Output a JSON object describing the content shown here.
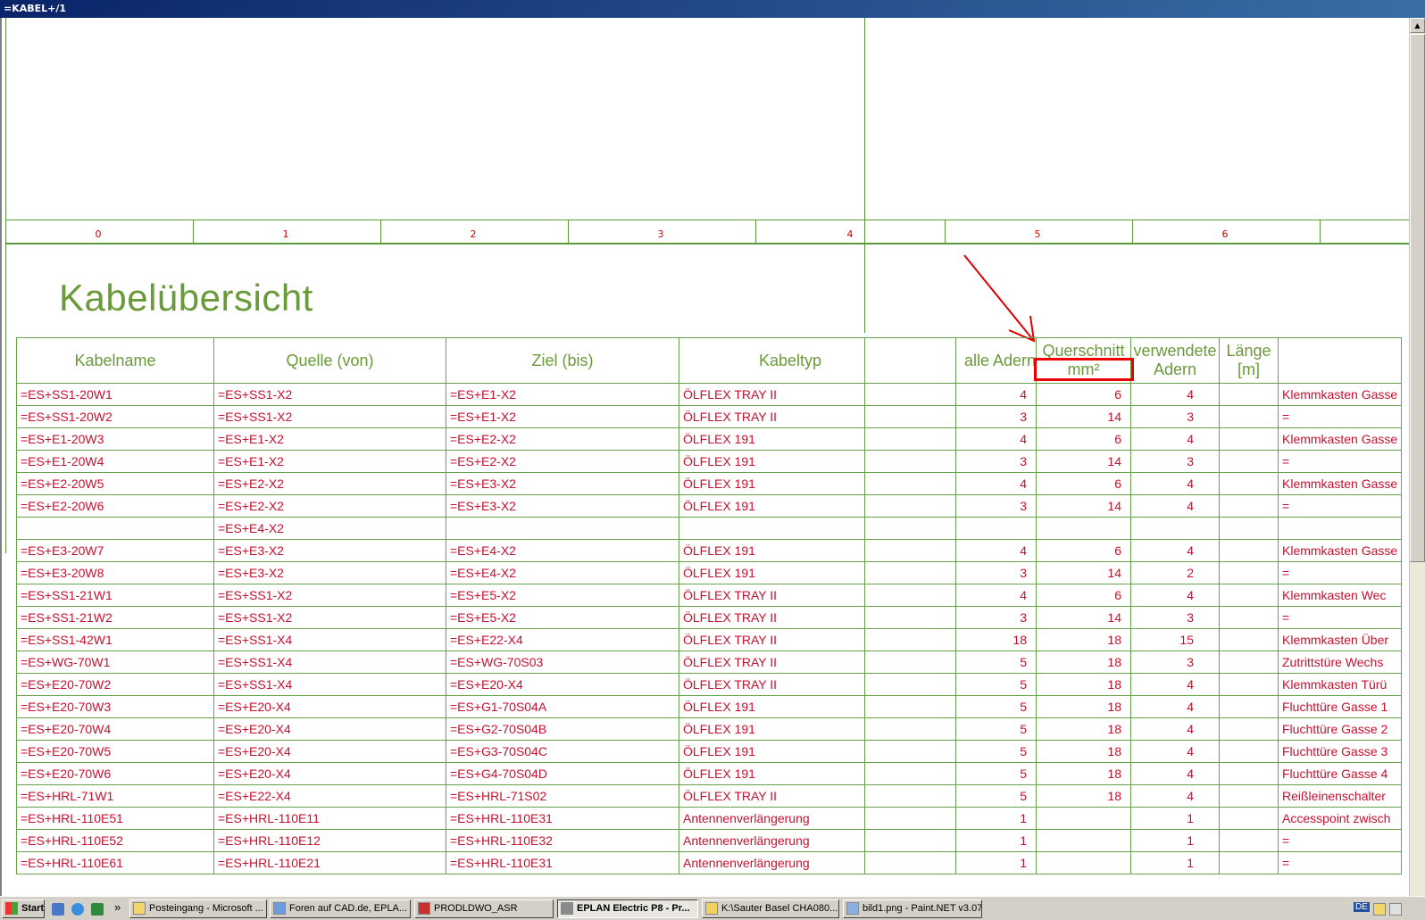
{
  "window": {
    "title": "=KABEL+/1"
  },
  "drawing": {
    "column_numbers": [
      "0",
      "1",
      "2",
      "3",
      "4",
      "5",
      "6"
    ],
    "page_title": "Kabelübersicht"
  },
  "table": {
    "headers": {
      "kabelname": "Kabelname",
      "quelle": "Quelle (von)",
      "ziel": "Ziel (bis)",
      "kabeltyp": "Kabeltyp",
      "blank": "",
      "alle_adern": "alle Adern",
      "querschnitt_1": "Querschnitt",
      "querschnitt_2": "mm²",
      "verwendete_1": "verwendete",
      "verwendete_2": "Adern",
      "laenge_1": "Länge",
      "laenge_2": "[m]",
      "last": ""
    },
    "rows": [
      [
        "=ES+SS1-20W1",
        "=ES+SS1-X2",
        "=ES+E1-X2",
        "ÖLFLEX TRAY II",
        "4",
        "6",
        "4",
        "",
        "Klemmkasten Gasse"
      ],
      [
        "=ES+SS1-20W2",
        "=ES+SS1-X2",
        "=ES+E1-X2",
        "ÖLFLEX TRAY II",
        "3",
        "14",
        "3",
        "",
        "="
      ],
      [
        "=ES+E1-20W3",
        "=ES+E1-X2",
        "=ES+E2-X2",
        "ÖLFLEX 191",
        "4",
        "6",
        "4",
        "",
        "Klemmkasten Gasse"
      ],
      [
        "=ES+E1-20W4",
        "=ES+E1-X2",
        "=ES+E2-X2",
        "ÖLFLEX 191",
        "3",
        "14",
        "3",
        "",
        "="
      ],
      [
        "=ES+E2-20W5",
        "=ES+E2-X2",
        "=ES+E3-X2",
        "ÖLFLEX 191",
        "4",
        "6",
        "4",
        "",
        "Klemmkasten Gasse"
      ],
      [
        "=ES+E2-20W6",
        "=ES+E2-X2",
        "=ES+E3-X2",
        "ÖLFLEX 191",
        "3",
        "14",
        "4",
        "",
        "="
      ],
      [
        "",
        "=ES+E4-X2",
        "",
        "",
        "",
        "",
        "",
        "",
        ""
      ],
      [
        "=ES+E3-20W7",
        "=ES+E3-X2",
        "=ES+E4-X2",
        "ÖLFLEX 191",
        "4",
        "6",
        "4",
        "",
        "Klemmkasten Gasse"
      ],
      [
        "=ES+E3-20W8",
        "=ES+E3-X2",
        "=ES+E4-X2",
        "ÖLFLEX 191",
        "3",
        "14",
        "2",
        "",
        "="
      ],
      [
        "=ES+SS1-21W1",
        "=ES+SS1-X2",
        "=ES+E5-X2",
        "ÖLFLEX TRAY II",
        "4",
        "6",
        "4",
        "",
        "Klemmkasten Wec"
      ],
      [
        "=ES+SS1-21W2",
        "=ES+SS1-X2",
        "=ES+E5-X2",
        "ÖLFLEX TRAY II",
        "3",
        "14",
        "3",
        "",
        "="
      ],
      [
        "=ES+SS1-42W1",
        "=ES+SS1-X4",
        "=ES+E22-X4",
        "ÖLFLEX TRAY II",
        "18",
        "18",
        "15",
        "",
        "Klemmkasten Über"
      ],
      [
        "=ES+WG-70W1",
        "=ES+SS1-X4",
        "=ES+WG-70S03",
        "ÖLFLEX TRAY II",
        "5",
        "18",
        "3",
        "",
        "Zutrittstüre Wechs"
      ],
      [
        "=ES+E20-70W2",
        "=ES+SS1-X4",
        "=ES+E20-X4",
        "ÖLFLEX TRAY II",
        "5",
        "18",
        "4",
        "",
        "Klemmkasten Türü"
      ],
      [
        "=ES+E20-70W3",
        "=ES+E20-X4",
        "=ES+G1-70S04A",
        "ÖLFLEX 191",
        "5",
        "18",
        "4",
        "",
        "Fluchttüre Gasse 1"
      ],
      [
        "=ES+E20-70W4",
        "=ES+E20-X4",
        "=ES+G2-70S04B",
        "ÖLFLEX 191",
        "5",
        "18",
        "4",
        "",
        "Fluchttüre Gasse 2"
      ],
      [
        "=ES+E20-70W5",
        "=ES+E20-X4",
        "=ES+G3-70S04C",
        "ÖLFLEX 191",
        "5",
        "18",
        "4",
        "",
        "Fluchttüre Gasse 3"
      ],
      [
        "=ES+E20-70W6",
        "=ES+E20-X4",
        "=ES+G4-70S04D",
        "ÖLFLEX 191",
        "5",
        "18",
        "4",
        "",
        "Fluchttüre Gasse 4"
      ],
      [
        "=ES+HRL-71W1",
        "=ES+E22-X4",
        "=ES+HRL-71S02",
        "ÖLFLEX TRAY II",
        "5",
        "18",
        "4",
        "",
        "Reißleinenschalter"
      ],
      [
        "=ES+HRL-110E51",
        "=ES+HRL-110E11",
        "=ES+HRL-110E31",
        "Antennenverlängerung",
        "1",
        "",
        "1",
        "",
        "Accesspoint zwisch"
      ],
      [
        "=ES+HRL-110E52",
        "=ES+HRL-110E12",
        "=ES+HRL-110E32",
        "Antennenverlängerung",
        "1",
        "",
        "1",
        "",
        "="
      ],
      [
        "=ES+HRL-110E61",
        "=ES+HRL-110E21",
        "=ES+HRL-110E31",
        "Antennenverlängerung",
        "1",
        "",
        "1",
        "",
        "="
      ]
    ]
  },
  "taskbar": {
    "start_label": "Start",
    "overflow": "»",
    "items": [
      "Posteingang - Microsoft ...",
      "Foren auf CAD.de, EPLA...",
      "PRODLDWO_ASR",
      "EPLAN Electric P8 - Pr...",
      "K:\\Sauter Basel CHA080...",
      "bild1.png - Paint.NET v3.07"
    ],
    "tray_lang": "DE"
  },
  "colors": {
    "grid_green": "#5a9a3a",
    "text_red": "#c8102e",
    "title_green": "#6a9a3a",
    "highlight": "#e00000"
  },
  "icons": [
    "arrow-icon",
    "window-icon",
    "outlook-icon",
    "ie-icon",
    "excel-icon"
  ]
}
